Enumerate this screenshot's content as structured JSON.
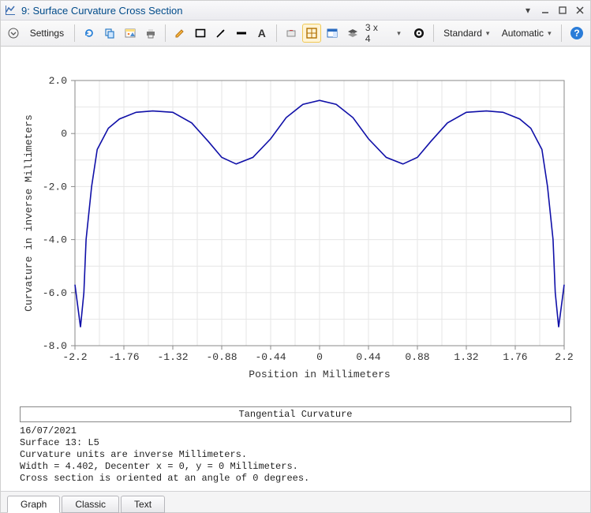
{
  "window": {
    "title": "9: Surface Curvature Cross Section"
  },
  "toolbar": {
    "settings_label": "Settings",
    "grid_label": "3 x 4",
    "standard_label": "Standard",
    "automatic_label": "Automatic"
  },
  "legend": {
    "label": "Tangential Curvature"
  },
  "info": {
    "line1": "16/07/2021",
    "line2": "Surface 13: L5",
    "line3": "Curvature units are inverse Millimeters.",
    "line4": "Width = 4.402, Decenter x = 0, y = 0 Millimeters.",
    "line5": "Cross section is oriented at an angle of 0 degrees."
  },
  "tabs": {
    "items": [
      {
        "label": "Graph",
        "active": true
      },
      {
        "label": "Classic",
        "active": false
      },
      {
        "label": "Text",
        "active": false
      }
    ]
  },
  "chart_data": {
    "type": "line",
    "title": "",
    "xlabel": "Position in Millimeters",
    "ylabel": "Curvature in inverse Millimeters",
    "xlim": [
      -2.2,
      2.2
    ],
    "ylim": [
      -8.0,
      2.0
    ],
    "x_ticks": [
      -2.2,
      -1.76,
      -1.32,
      -0.88,
      -0.44,
      0,
      0.44,
      0.88,
      1.32,
      1.76,
      2.2
    ],
    "y_ticks": [
      -8.0,
      -6.0,
      -4.0,
      -2.0,
      0,
      2.0
    ],
    "x_tick_labels": [
      "-2.2",
      "-1.76",
      "-1.32",
      "-0.88",
      "-0.44",
      "0",
      "0.44",
      "0.88",
      "1.32",
      "1.76",
      "2.2"
    ],
    "y_tick_labels": [
      "-8.0",
      "-6.0",
      "-4.0",
      "-2.0",
      "0",
      "2.0"
    ],
    "series": [
      {
        "name": "Tangential Curvature",
        "color": "#1010a8",
        "x": [
          -2.2,
          -2.15,
          -2.12,
          -2.1,
          -2.05,
          -2.0,
          -1.9,
          -1.8,
          -1.65,
          -1.5,
          -1.32,
          -1.15,
          -1.0,
          -0.88,
          -0.75,
          -0.6,
          -0.44,
          -0.3,
          -0.15,
          0.0,
          0.15,
          0.3,
          0.44,
          0.6,
          0.75,
          0.88,
          1.0,
          1.15,
          1.32,
          1.5,
          1.65,
          1.8,
          1.9,
          2.0,
          2.05,
          2.1,
          2.12,
          2.15,
          2.2
        ],
        "y": [
          -5.7,
          -7.3,
          -6.0,
          -4.0,
          -2.0,
          -0.6,
          0.2,
          0.55,
          0.8,
          0.85,
          0.8,
          0.4,
          -0.3,
          -0.9,
          -1.15,
          -0.9,
          -0.2,
          0.6,
          1.1,
          1.25,
          1.1,
          0.6,
          -0.2,
          -0.9,
          -1.15,
          -0.9,
          -0.3,
          0.4,
          0.8,
          0.85,
          0.8,
          0.55,
          0.2,
          -0.6,
          -2.0,
          -4.0,
          -6.0,
          -7.3,
          -5.7
        ]
      }
    ]
  }
}
